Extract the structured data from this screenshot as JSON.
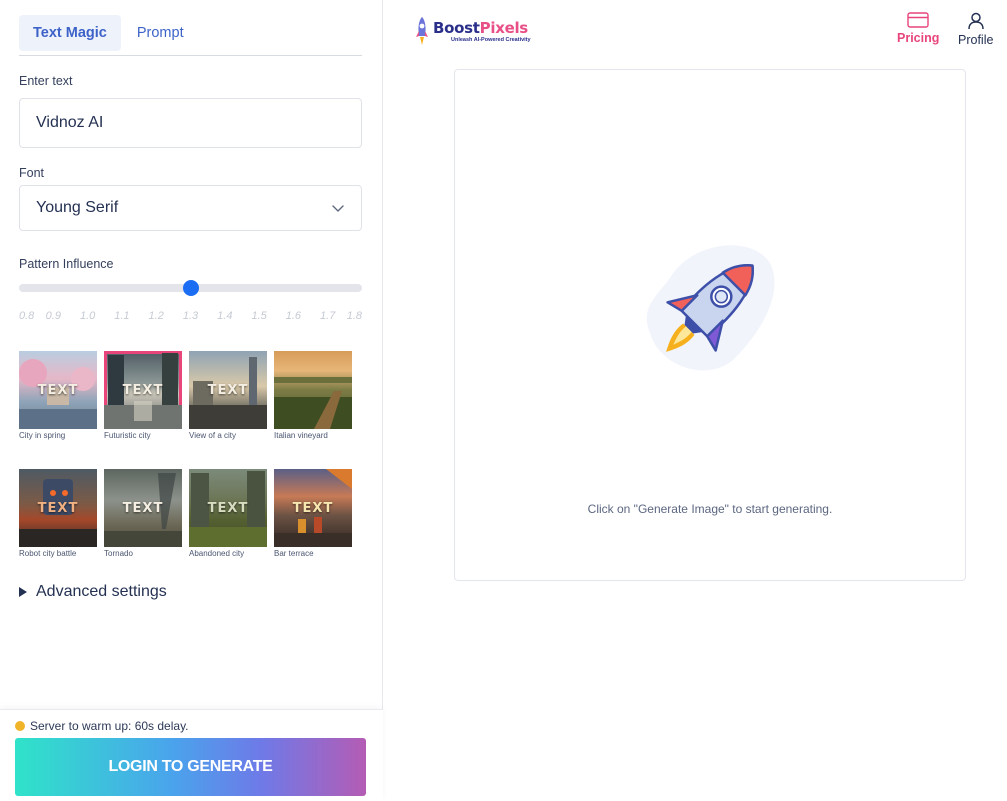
{
  "tabs": [
    {
      "label": "Text Magic",
      "active": true
    },
    {
      "label": "Prompt",
      "active": false
    }
  ],
  "text_input": {
    "label": "Enter text",
    "value": "Vidnoz AI"
  },
  "font_select": {
    "label": "Font",
    "value": "Young Serif",
    "icon": "chevron-down-icon"
  },
  "pattern_influence": {
    "label": "Pattern Influence",
    "value": 1.3,
    "min": 0.8,
    "max": 1.8,
    "ticks": [
      "0.8",
      "0.9",
      "1.0",
      "1.1",
      "1.2",
      "1.3",
      "1.4",
      "1.5",
      "1.6",
      "1.7",
      "1.8"
    ]
  },
  "styles": {
    "overlay_text": "TEXT",
    "row1": [
      {
        "caption": "City in spring",
        "selected": false
      },
      {
        "caption": "Futuristic city",
        "selected": true
      },
      {
        "caption": "View of a city",
        "selected": false
      },
      {
        "caption": "Italian vineyard",
        "selected": false
      }
    ],
    "row2": [
      {
        "caption": "Robot city battle",
        "selected": false
      },
      {
        "caption": "Tornado",
        "selected": false
      },
      {
        "caption": "Abandoned city",
        "selected": false
      },
      {
        "caption": "Bar terrace",
        "selected": false
      }
    ]
  },
  "advanced": {
    "label": "Advanced settings"
  },
  "footer": {
    "status": "Server to warm up: 60s delay.",
    "status_color": "#f0b429",
    "button": "LOGIN TO GENERATE"
  },
  "brand": {
    "name_part1": "Boost",
    "name_part2": "Pixels",
    "tagline": "Unleash AI-Powered Creativity"
  },
  "nav": {
    "pricing": {
      "label": "Pricing",
      "icon": "credit-card-icon"
    },
    "profile": {
      "label": "Profile",
      "icon": "user-icon"
    }
  },
  "canvas": {
    "hint": "Click on \"Generate Image\" to start generating.",
    "icon": "rocket-icon"
  },
  "colors": {
    "accent": "#3d63c9",
    "pricing": "#e8457a",
    "slider": "#1b6ef3",
    "selected_outline": "#e8457a"
  }
}
